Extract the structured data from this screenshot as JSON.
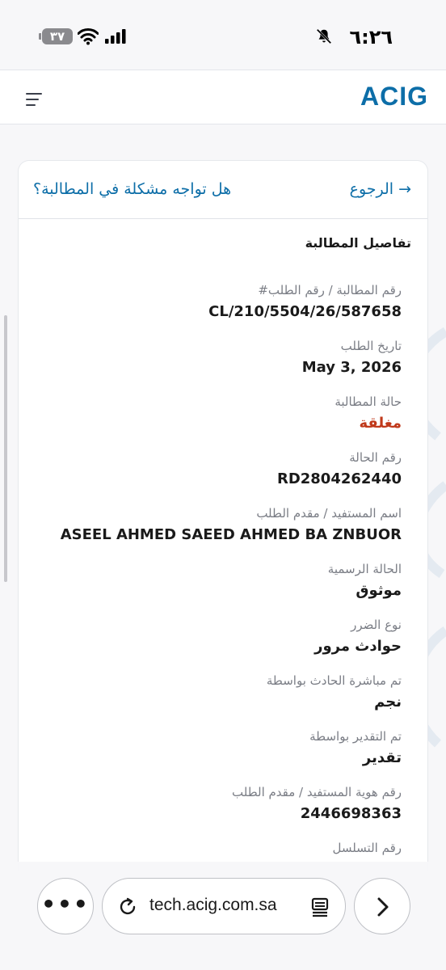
{
  "status_bar": {
    "time": "٦:٢٦",
    "battery": "٣٧"
  },
  "header": {
    "logo": "ACIG"
  },
  "card": {
    "back_label": "الرجوع",
    "problem_label": "هل تواجه مشكلة في المطالبة؟",
    "section_title": "تفاصيل المطالبة",
    "fields": [
      {
        "label": "رقم المطالبة / رقم الطلب#",
        "value": "CL/210/5504/26/587658"
      },
      {
        "label": "تاريخ الطلب",
        "value": "May 3, 2026"
      },
      {
        "label": "حالة المطالبة",
        "value": "مغلقة"
      },
      {
        "label": "رقم الحالة",
        "value": "RD2804262440"
      },
      {
        "label": "اسم المستفيد / مقدم الطلب",
        "value": "ASEEL AHMED SAEED AHMED BA ZNBUOR"
      },
      {
        "label": "الحالة الرسمية",
        "value": "موثوق"
      },
      {
        "label": "نوع الضرر",
        "value": "حوادث مرور"
      },
      {
        "label": "تم مباشرة الحادث بواسطة",
        "value": "نجم"
      },
      {
        "label": "تم التقدير بواسطة",
        "value": "تقدير"
      },
      {
        "label": "رقم هوية المستفيد / مقدم الطلب",
        "value": "2446698363"
      },
      {
        "label": "رقم التسلسل",
        "value": ""
      }
    ]
  },
  "browser": {
    "url": "tech.acig.com.sa"
  },
  "colors": {
    "brand": "#0d6ea8",
    "closed_status": "#c0391b"
  }
}
